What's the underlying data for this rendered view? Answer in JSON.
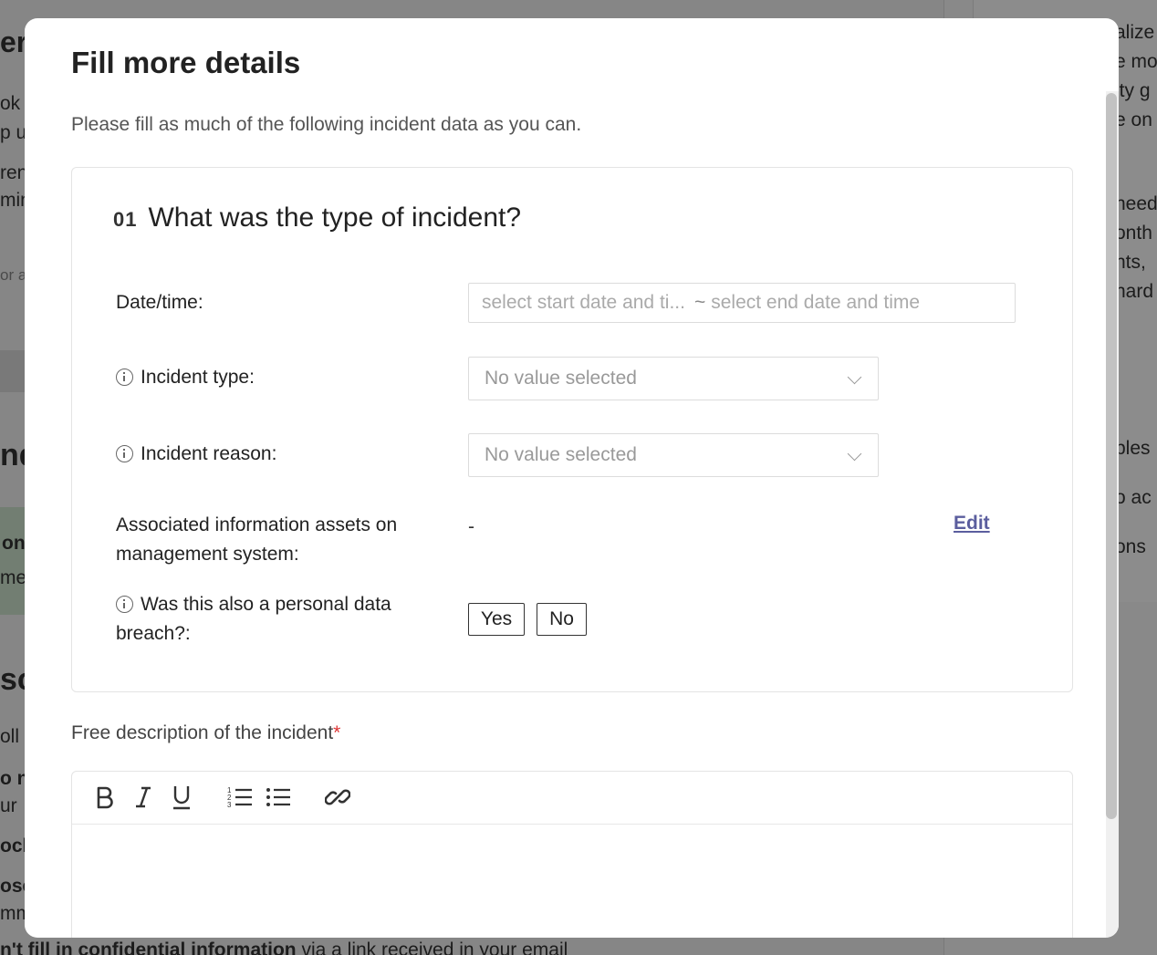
{
  "background": {
    "fragments": [
      "er",
      "ok",
      "p u",
      "ren",
      "min",
      "or a",
      "nd",
      "on",
      "me",
      "sc",
      "oll",
      "o no",
      "ur",
      "ock",
      "ose",
      "mm",
      "alize",
      "e mo",
      "ity g",
      "e on",
      "heed",
      "onth",
      "nts,",
      "hard",
      "ples",
      "o ac",
      "ons"
    ],
    "bottom_text_bold": "n't fill in confidential information",
    "bottom_text": " via a link received in your email"
  },
  "modal": {
    "title": "Fill more details",
    "subtitle": "Please fill as much of the following incident data as you can."
  },
  "section": {
    "number": "01",
    "title": "What was the type of incident?"
  },
  "fields": {
    "datetime": {
      "label": "Date/time:",
      "start_placeholder": "select start date and ti...",
      "separator": "~",
      "end_placeholder": "select end date and time"
    },
    "incident_type": {
      "label": "Incident type:",
      "value": "No value selected"
    },
    "incident_reason": {
      "label": "Incident reason:",
      "value": "No value selected"
    },
    "assets": {
      "label_line1": "Associated information assets on",
      "label_line2": "management system:",
      "value": "-",
      "edit_label": "Edit"
    },
    "personal_breach": {
      "label_line1": "Was this also a personal data",
      "label_line2": "breach?:",
      "yes_label": "Yes",
      "no_label": "No"
    }
  },
  "description": {
    "label": "Free description of the incident",
    "required_mark": "*"
  },
  "toolbar": {
    "icons": [
      "bold-icon",
      "italic-icon",
      "underline-icon",
      "ordered-list-icon",
      "bullet-list-icon",
      "link-icon"
    ]
  }
}
